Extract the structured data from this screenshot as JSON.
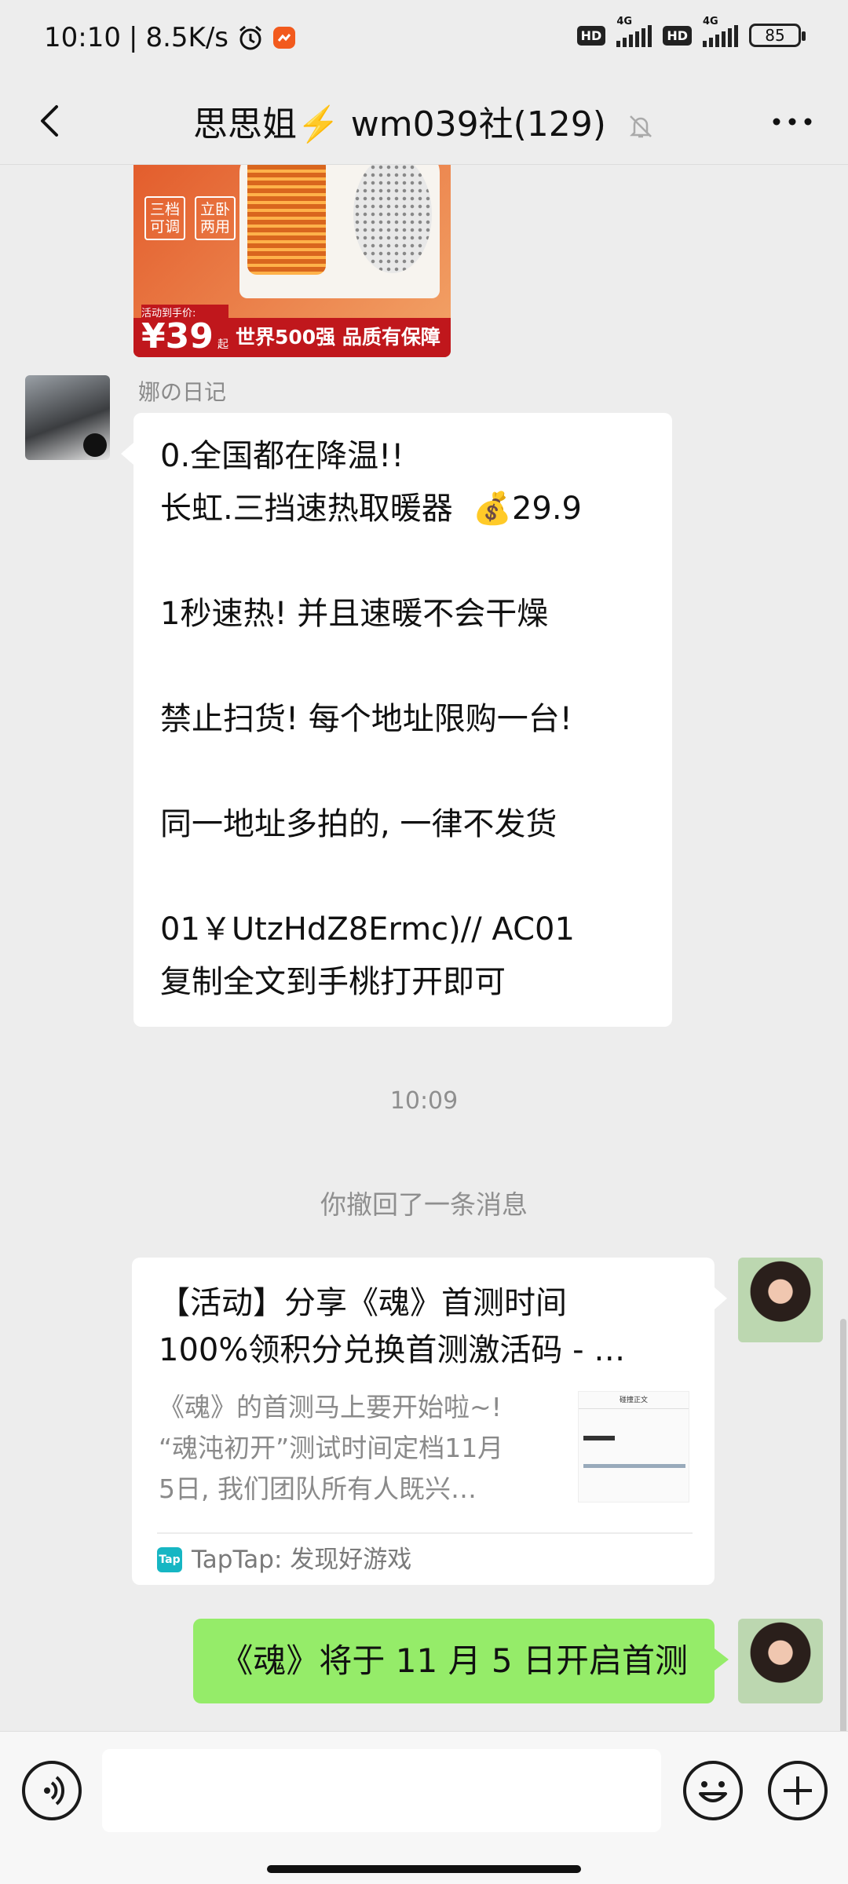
{
  "status_bar": {
    "time": "10:10",
    "speed": "8.5K/s",
    "hd1": "HD",
    "net1": "4G",
    "hd2": "HD",
    "net2": "4G",
    "battery": "85"
  },
  "header": {
    "title": "思思姐⚡️ wm039社(129)",
    "back_icon": "chevron-left-icon",
    "mute_icon": "bell-off-icon",
    "more_icon": "more-horizontal-icon"
  },
  "promo_image": {
    "badge1": "三档\n可调",
    "badge2": "立卧\n两用",
    "price_label": "活动到手价:",
    "price": "¥39",
    "price_suffix": "起",
    "banner": "世界500强 品质有保障"
  },
  "message1": {
    "sender": "娜の日记",
    "lines": [
      "0.全国都在降温!!",
      "长虹.三挡速热取暖器  💰29.9",
      "",
      "1秒速热! 并且速暖不会干燥",
      "",
      "禁止扫货! 每个地址限购一台!",
      "",
      "同一地址多拍的, 一律不发货",
      "",
      "01￥UtzHdZ8Ermc)// AC01",
      "复制全文到手桃打开即可"
    ]
  },
  "timestamp": "10:09",
  "recall_notice": "你撤回了一条消息",
  "link_card": {
    "title_line1": "【活动】分享《魂》首测时间",
    "title_line2": "100%领积分兑换首测激活码 - …",
    "desc_line1": "《魂》的首测马上要开始啦~!",
    "desc_line2": "“魂沌初开”测试时间定档11月",
    "desc_line3": "5日, 我们团队所有人既兴…",
    "thumb_header": "碰撞正文",
    "source_icon_text": "Tap",
    "source": "TapTap: 发现好游戏"
  },
  "sent_message": "《魂》将于 11 月 5 日开启首测",
  "input_bar": {
    "voice_icon": "voice-icon",
    "emoji_icon": "emoji-icon",
    "plus_icon": "plus-icon"
  }
}
